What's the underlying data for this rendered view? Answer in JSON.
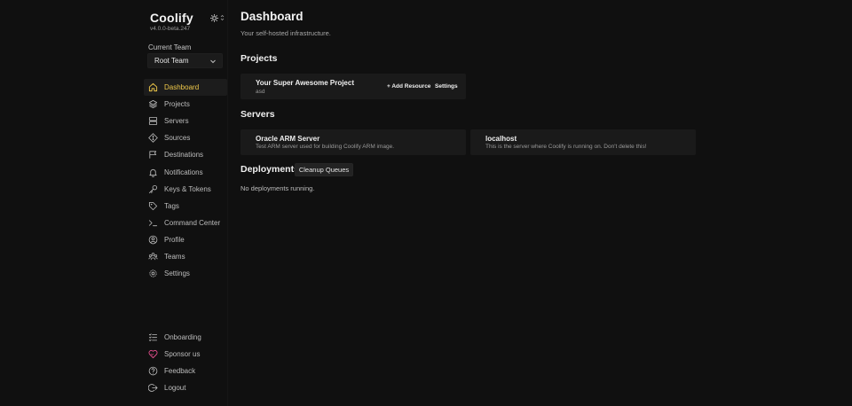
{
  "brand": {
    "title": "Coolify",
    "version": "v4.0.0-beta.247"
  },
  "team": {
    "label": "Current Team",
    "selected": "Root Team"
  },
  "nav": {
    "items": [
      {
        "label": "Dashboard",
        "icon": "home-icon",
        "active": true
      },
      {
        "label": "Projects",
        "icon": "layers-icon"
      },
      {
        "label": "Servers",
        "icon": "server-icon"
      },
      {
        "label": "Sources",
        "icon": "git-icon"
      },
      {
        "label": "Destinations",
        "icon": "destination-icon"
      },
      {
        "label": "Notifications",
        "icon": "bell-icon"
      },
      {
        "label": "Keys & Tokens",
        "icon": "key-icon"
      },
      {
        "label": "Tags",
        "icon": "tag-icon"
      },
      {
        "label": "Command Center",
        "icon": "terminal-icon"
      },
      {
        "label": "Profile",
        "icon": "user-icon"
      },
      {
        "label": "Teams",
        "icon": "users-icon"
      },
      {
        "label": "Settings",
        "icon": "gear-icon"
      }
    ],
    "bottom": [
      {
        "label": "Onboarding",
        "icon": "checklist-icon"
      },
      {
        "label": "Sponsor us",
        "icon": "heart-icon"
      },
      {
        "label": "Feedback",
        "icon": "help-icon"
      },
      {
        "label": "Logout",
        "icon": "logout-icon"
      }
    ]
  },
  "colors": {
    "accent": "#f0c94a",
    "heart": "#e04d8a",
    "background": "#101010",
    "card": "#1a1a1a"
  },
  "main": {
    "title": "Dashboard",
    "subtitle": "Your self-hosted infrastructure.",
    "projects": {
      "heading": "Projects",
      "items": [
        {
          "name": "Your Super Awesome Project",
          "description": "asd",
          "add_resource": "+ Add Resource",
          "settings": "Settings"
        }
      ]
    },
    "servers": {
      "heading": "Servers",
      "items": [
        {
          "name": "Oracle ARM Server",
          "description": "Test ARM server used for building Coolify ARM image."
        },
        {
          "name": "localhost",
          "description": "This is the server where Coolify is running on. Don't delete this!"
        }
      ]
    },
    "deployments": {
      "heading": "Deployments",
      "cleanup_label": "Cleanup Queues",
      "empty_text": "No deployments running."
    }
  }
}
